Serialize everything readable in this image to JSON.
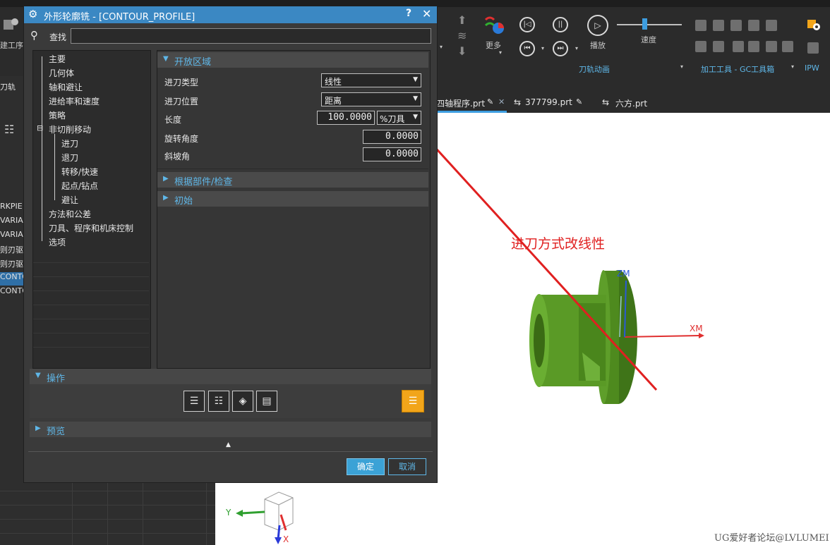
{
  "ribbon": {
    "more_label": "更多",
    "play_label": "播放",
    "speed_label": "速度",
    "group_animation": "刀轨动画",
    "group_tools": "加工工具 - GC工具箱",
    "group_ipw": "IPW",
    "left_create": "建工序",
    "colors": {
      "ribbon_bg": "#2b2b2b",
      "accent": "#3b88c3"
    }
  },
  "tabs": [
    {
      "label": "四轴程序.prt",
      "active": true
    },
    {
      "label": "377799.prt",
      "active": false
    },
    {
      "label": "六方.prt",
      "active": false
    }
  ],
  "left_nav": {
    "header": "刀轨",
    "rows": [
      "RKPIE",
      "VARIA",
      "VARIA",
      "则刃驱",
      "则刃驱",
      "CONTO",
      "CONTO"
    ],
    "selected_index": 5
  },
  "dialog": {
    "title": "外形轮廓铣 - [CONTOUR_PROFILE]",
    "help": "?",
    "close": "✕",
    "find_label": "查找",
    "tree": [
      {
        "label": "主要",
        "level": 0
      },
      {
        "label": "几何体",
        "level": 0
      },
      {
        "label": "轴和避让",
        "level": 0
      },
      {
        "label": "进给率和速度",
        "level": 0
      },
      {
        "label": "策略",
        "level": 0
      },
      {
        "label": "非切削移动",
        "level": 0,
        "expander": "⊟"
      },
      {
        "label": "进刀",
        "level": 1,
        "selected": true
      },
      {
        "label": "退刀",
        "level": 1
      },
      {
        "label": "转移/快速",
        "level": 1
      },
      {
        "label": "起点/钻点",
        "level": 1
      },
      {
        "label": "避让",
        "level": 1
      },
      {
        "label": "方法和公差",
        "level": 0
      },
      {
        "label": "刀具、程序和机床控制",
        "level": 0
      },
      {
        "label": "选项",
        "level": 0
      }
    ],
    "open_region": {
      "header": "开放区域",
      "engage_type_label": "进刀类型",
      "engage_type_value": "线性",
      "engage_pos_label": "进刀位置",
      "engage_pos_value": "距离",
      "length_label": "长度",
      "length_value": "100.0000",
      "length_unit": "%刀具",
      "rotation_label": "旋转角度",
      "rotation_value": "0.0000",
      "ramp_label": "斜坡角",
      "ramp_value": "0.0000"
    },
    "section_part_check": "根据部件/检查",
    "section_initial": "初始",
    "operations_header": "操作",
    "preview_header": "预览",
    "ok": "确定",
    "cancel": "取消"
  },
  "viewport": {
    "annotation": "进刀方式改线性",
    "annotation_color": "#e02020",
    "axis_xm": "XM",
    "axis_zm": "ZM",
    "triad_y": "Y",
    "triad_x": "X",
    "watermark": "UG爱好者论坛@LVLUMEI",
    "part_color": "#4e8a1e"
  }
}
